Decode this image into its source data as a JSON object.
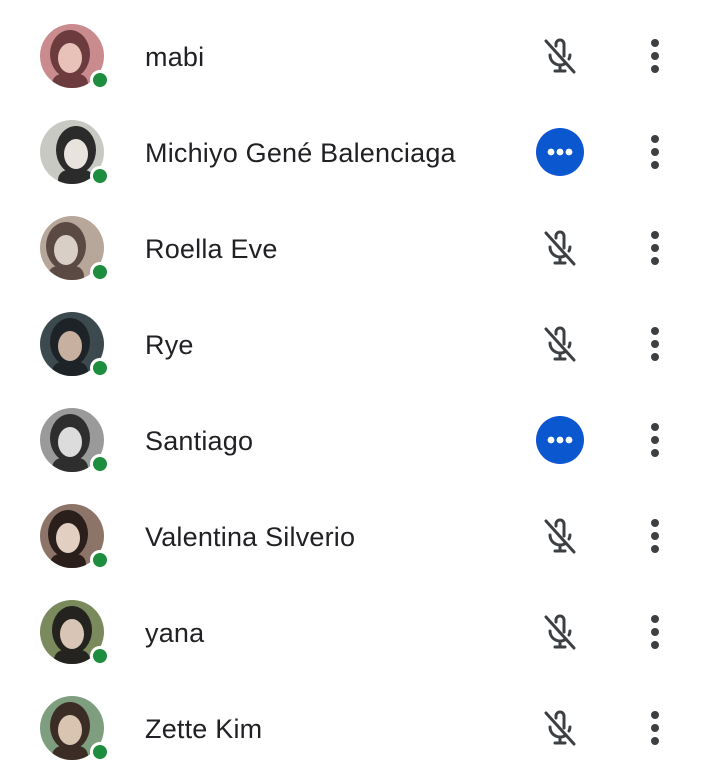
{
  "participants": [
    {
      "name": "mabi",
      "status": "muted",
      "status_icon": "mic-off-icon",
      "online": true,
      "avatar_colors": [
        "#c98b8e",
        "#6b3b3e",
        "#e8c2b8"
      ]
    },
    {
      "name": "Michiyo Gené Balenciaga",
      "status": "busy",
      "status_icon": "more-horizontal-icon",
      "online": true,
      "avatar_colors": [
        "#c9c9c4",
        "#2b2b2b",
        "#e9e3de"
      ]
    },
    {
      "name": "Roella Eve",
      "status": "muted",
      "status_icon": "mic-off-icon",
      "online": true,
      "avatar_colors": [
        "#b7a79a",
        "#5a4a43",
        "#d9cfc6"
      ]
    },
    {
      "name": "Rye",
      "status": "muted",
      "status_icon": "mic-off-icon",
      "online": true,
      "avatar_colors": [
        "#3c4a4f",
        "#1d2326",
        "#c7b0a0"
      ]
    },
    {
      "name": "Santiago",
      "status": "busy",
      "status_icon": "more-horizontal-icon",
      "online": true,
      "avatar_colors": [
        "#9a9a9a",
        "#2e2e2e",
        "#dcdcdc"
      ]
    },
    {
      "name": "Valentina Silverio",
      "status": "muted",
      "status_icon": "mic-off-icon",
      "online": true,
      "avatar_colors": [
        "#8d7468",
        "#2a1f1b",
        "#e2cfc2"
      ]
    },
    {
      "name": "yana",
      "status": "muted",
      "status_icon": "mic-off-icon",
      "online": true,
      "avatar_colors": [
        "#7a8a5c",
        "#24231f",
        "#d8c5b5"
      ]
    },
    {
      "name": "Zette Kim",
      "status": "muted",
      "status_icon": "mic-off-icon",
      "online": true,
      "avatar_colors": [
        "#7f9e80",
        "#3b2d25",
        "#d9c4b1"
      ]
    }
  ],
  "colors": {
    "online_dot": "#1e8e3e",
    "busy_bg": "#0b57d0",
    "icon_gray": "#3c4043",
    "text": "#202124"
  },
  "row_menu_icon": "more-vertical-icon"
}
